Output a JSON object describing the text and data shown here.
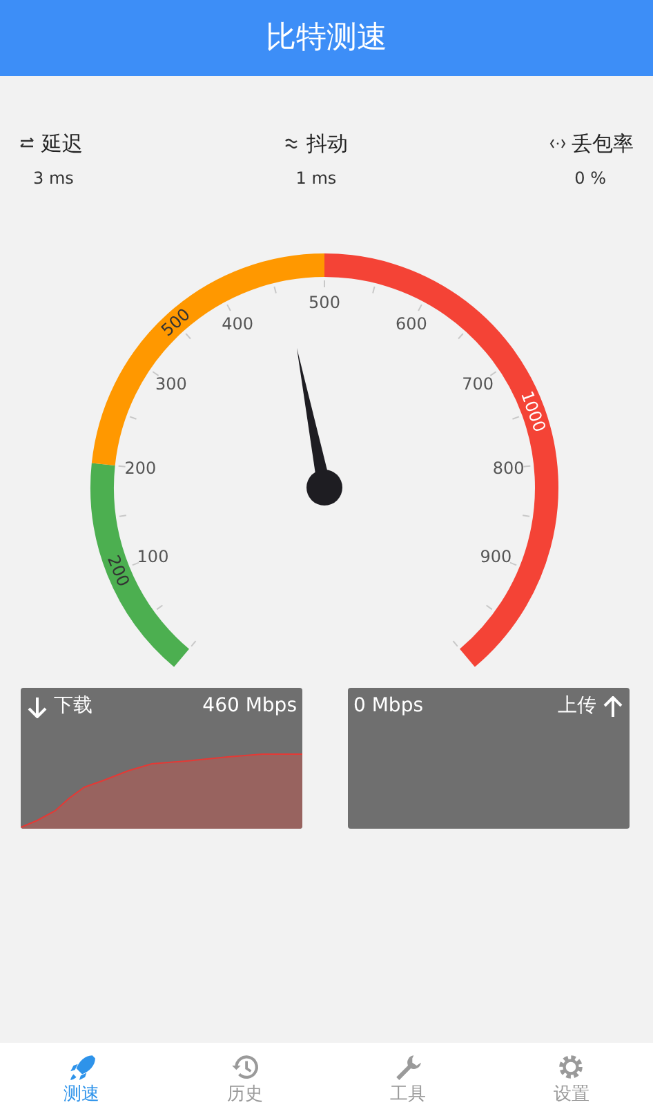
{
  "app_bar": {
    "title": "比特测速"
  },
  "metrics": [
    {
      "kind": "latency",
      "label": "延迟",
      "value": "3 ms"
    },
    {
      "kind": "jitter",
      "label": "抖动",
      "value": "1 ms"
    },
    {
      "kind": "loss",
      "label": "丢包率",
      "value": "0 %"
    }
  ],
  "gauge": {
    "scale_labels": [
      "100",
      "200",
      "300",
      "400",
      "500",
      "600",
      "700",
      "800",
      "900"
    ],
    "bands": [
      {
        "label": "200",
        "color": "#4caf50"
      },
      {
        "label": "500",
        "color": "#ff9800"
      },
      {
        "label": "1000",
        "color": "#f44336"
      }
    ]
  },
  "panels": [
    {
      "kind": "download",
      "label": "下载",
      "reading": "460 Mbps"
    },
    {
      "kind": "upload",
      "label": "上传",
      "reading": "0 Mbps"
    }
  ],
  "tabs": [
    {
      "kind": "speed",
      "label": "测速",
      "selected": true
    },
    {
      "kind": "history",
      "label": "历史",
      "selected": false
    },
    {
      "kind": "tools",
      "label": "工具",
      "selected": false
    },
    {
      "kind": "settings",
      "label": "设置",
      "selected": false
    }
  ]
}
